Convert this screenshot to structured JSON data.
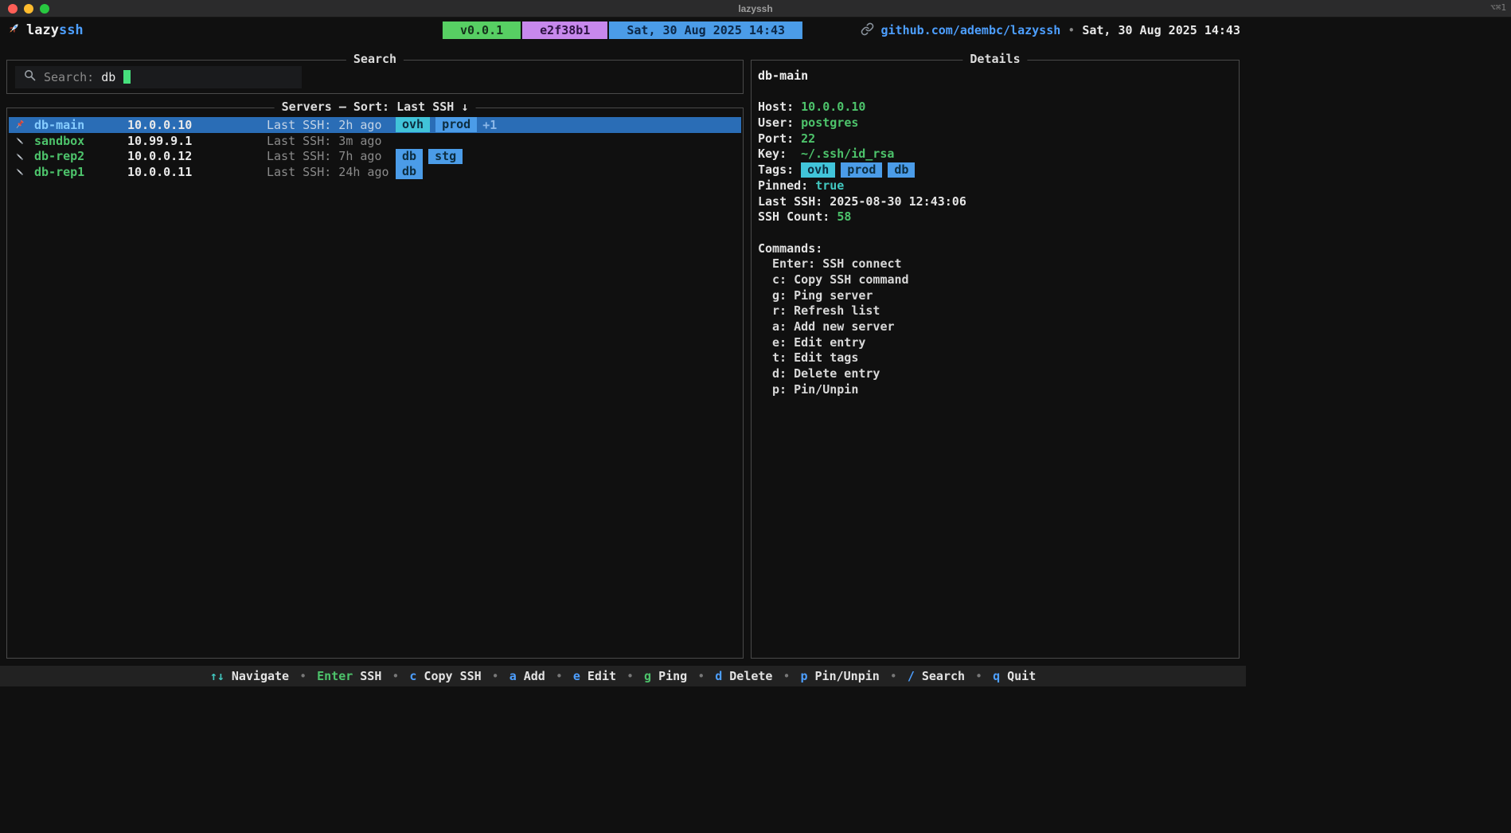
{
  "window": {
    "title": "lazyssh",
    "shortcut_hint": "⌥⌘1"
  },
  "header": {
    "logo_icon": "rocket-icon",
    "app_name": {
      "bold": "lazy",
      "accent": "ssh"
    },
    "version_badge": "v0.0.1",
    "commit_badge": "e2f38b1",
    "date_badge": "Sat, 30 Aug 2025 14:43",
    "link_icon": "link-icon",
    "repo_link": "github.com/adembc/lazyssh",
    "separator": "•",
    "datetime": "Sat, 30 Aug 2025 14:43"
  },
  "search": {
    "panel_title": "Search",
    "icon": "magnifier-icon",
    "label": "Search:",
    "value": "db"
  },
  "servers": {
    "panel_title": "Servers — Sort: Last SSH ↓",
    "rows": [
      {
        "icon": "pin-icon",
        "name": "db-main",
        "ip": "10.0.0.10",
        "last_ssh": "Last SSH: 2h ago",
        "tags": [
          "ovh",
          "prod"
        ],
        "extra": "+1",
        "selected": true
      },
      {
        "icon": "pencil-icon",
        "name": "sandbox",
        "ip": "10.99.9.1",
        "last_ssh": "Last SSH: 3m ago",
        "tags": [],
        "extra": "",
        "selected": false
      },
      {
        "icon": "pencil-icon",
        "name": "db-rep2",
        "ip": "10.0.0.12",
        "last_ssh": "Last SSH: 7h ago",
        "tags": [
          "db",
          "stg"
        ],
        "extra": "",
        "selected": false
      },
      {
        "icon": "pencil-icon",
        "name": "db-rep1",
        "ip": "10.0.0.11",
        "last_ssh": "Last SSH: 24h ago",
        "tags": [
          "db"
        ],
        "extra": "",
        "selected": false
      }
    ]
  },
  "details": {
    "panel_title": "Details",
    "server_name": "db-main",
    "fields": [
      {
        "label": "Host:",
        "value": "10.0.0.10",
        "style": "green"
      },
      {
        "label": "User:",
        "value": "postgres",
        "style": "green"
      },
      {
        "label": "Port:",
        "value": "22",
        "style": "green"
      },
      {
        "label": "Key:",
        "value": "~/.ssh/id_rsa",
        "style": "green"
      }
    ],
    "tags_label": "Tags:",
    "tags": [
      "ovh",
      "prod",
      "db"
    ],
    "after_fields": [
      {
        "label": "Pinned:",
        "value": "true",
        "style": "teal"
      },
      {
        "label": "Last SSH:",
        "value": "2025-08-30 12:43:06",
        "style": "white"
      },
      {
        "label": "SSH Count:",
        "value": "58",
        "style": "green"
      }
    ],
    "commands_title": "Commands:",
    "commands": [
      {
        "key": "Enter",
        "desc": "SSH connect"
      },
      {
        "key": "c",
        "desc": "Copy SSH command"
      },
      {
        "key": "g",
        "desc": "Ping server"
      },
      {
        "key": "r",
        "desc": "Refresh list"
      },
      {
        "key": "a",
        "desc": "Add new server"
      },
      {
        "key": "e",
        "desc": "Edit entry"
      },
      {
        "key": "t",
        "desc": "Edit tags"
      },
      {
        "key": "d",
        "desc": "Delete entry"
      },
      {
        "key": "p",
        "desc": "Pin/Unpin"
      }
    ]
  },
  "footer": {
    "separator": "•",
    "items": [
      {
        "key": "↑↓",
        "label": "Navigate",
        "key_color": "cyan"
      },
      {
        "key": "Enter",
        "label": "SSH",
        "key_color": "green"
      },
      {
        "key": "c",
        "label": "Copy SSH",
        "key_color": "blue"
      },
      {
        "key": "a",
        "label": "Add",
        "key_color": "blue"
      },
      {
        "key": "e",
        "label": "Edit",
        "key_color": "blue"
      },
      {
        "key": "g",
        "label": "Ping",
        "key_color": "green"
      },
      {
        "key": "d",
        "label": "Delete",
        "key_color": "blue"
      },
      {
        "key": "p",
        "label": "Pin/Unpin",
        "key_color": "blue"
      },
      {
        "key": "/",
        "label": "Search",
        "key_color": "blue"
      },
      {
        "key": "q",
        "label": "Quit",
        "key_color": "blue"
      }
    ]
  },
  "tag_styles": {
    "ovh": "cyan",
    "prod": "blue",
    "db": "blue",
    "stg": "blue"
  },
  "colors": {
    "bg": "#101010",
    "titlebar_bg": "#2b2b2c",
    "border": "#4a4a4a",
    "text": "#e6e6e6",
    "muted": "#8a8a8a",
    "blue": "#4d9fff",
    "green": "#4dc36b",
    "teal": "#42c8c0",
    "cursor": "#46e07c",
    "selected_bg": "#2a6db6",
    "selected_name": "#86cdff",
    "selected_muted": "#c4d4e6",
    "badge_green": "#57cf63",
    "badge_green_fg": "#16321c",
    "badge_purple": "#c788ec",
    "badge_purple_fg": "#2d1342",
    "badge_blue": "#4b9ce8",
    "badge_blue_fg": "#0c2746",
    "tag_cyan": "#41c4d9",
    "tag_blue": "#4b9ce8",
    "tag_fg": "#0d2d3f",
    "extra_count": "#8cb8e8",
    "footer_bg": "#222222",
    "field_bg": "#1a1b1d",
    "traffic_red": "#ff5f57",
    "traffic_yellow": "#febc2e",
    "traffic_green": "#28c840"
  }
}
